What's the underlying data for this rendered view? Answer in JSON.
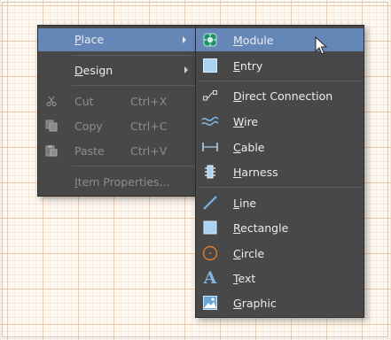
{
  "main_menu": {
    "items": [
      {
        "label": "Place",
        "mnemonic": "P",
        "rest": "lace",
        "has_submenu": true,
        "state": "highlighted"
      },
      {
        "label": "Design",
        "mnemonic": "D",
        "rest": "esign",
        "has_submenu": true
      },
      {
        "label": "Cut",
        "shortcut": "Ctrl+X",
        "icon": "scissors-icon",
        "state": "disabled"
      },
      {
        "label": "Copy",
        "shortcut": "Ctrl+C",
        "icon": "copy-icon",
        "state": "disabled"
      },
      {
        "label": "Paste",
        "shortcut": "Ctrl+V",
        "icon": "paste-icon",
        "state": "disabled"
      },
      {
        "label": "Item Properties...",
        "mnemonic": "I",
        "rest": "tem Properties...",
        "state": "disabled"
      }
    ]
  },
  "place_submenu": {
    "items": [
      {
        "label": "Module",
        "mnemonic": "M",
        "rest": "odule",
        "icon": "module-icon",
        "state": "highlighted"
      },
      {
        "label": "Entry",
        "mnemonic": "E",
        "rest": "ntry",
        "icon": "entry-icon"
      },
      {
        "label": "Direct Connection",
        "mnemonic": "D",
        "rest": "irect Connection",
        "icon": "direct-connection-icon"
      },
      {
        "label": "Wire",
        "mnemonic": "W",
        "rest": "ire",
        "icon": "wire-icon"
      },
      {
        "label": "Cable",
        "mnemonic": "C",
        "rest": "able",
        "icon": "cable-icon"
      },
      {
        "label": "Harness",
        "mnemonic": "H",
        "rest": "arness",
        "icon": "harness-icon"
      },
      {
        "label": "Line",
        "mnemonic": "L",
        "rest": "ine",
        "icon": "line-icon"
      },
      {
        "label": "Rectangle",
        "mnemonic": "R",
        "rest": "ectangle",
        "icon": "rectangle-icon"
      },
      {
        "label": "Circle",
        "mnemonic": "C",
        "rest": "ircle",
        "icon": "circle-icon"
      },
      {
        "label": "Text",
        "mnemonic": "T",
        "rest": "ext",
        "icon": "text-icon"
      },
      {
        "label": "Graphic",
        "mnemonic": "G",
        "rest": "raphic",
        "icon": "graphic-icon"
      }
    ]
  },
  "colors": {
    "menu_bg": "#484848",
    "highlight": "#6587b8",
    "text": "#ececec",
    "disabled_text": "#8d8d8d",
    "icon_blue": "#7fb6e6",
    "icon_orange": "#e07b2a",
    "canvas_bg": "#fdf8f2",
    "grid": "#f3c9a4"
  }
}
